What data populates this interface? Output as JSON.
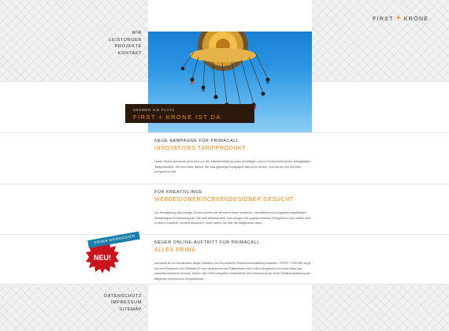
{
  "brand": {
    "logo_left": "FIRST",
    "logo_plus": "+",
    "logo_right": "KRONE"
  },
  "nav": {
    "items": [
      {
        "label": "WIR"
      },
      {
        "label": "LEISTUNGEN"
      },
      {
        "label": "PROJEKTE"
      },
      {
        "label": "KONTAKT"
      }
    ]
  },
  "hero": {
    "banner_subtitle": "NEHMEN SIE PLATZ",
    "banner_title": "FIRST + KRONE IST DA"
  },
  "sections": [
    {
      "kicker": "NEUE KAMPAGNE FÜR PRIMACALL",
      "headline": "INNOVATIVES TARIFPRODUKT",
      "body": "Unser Kunde primacall steht kurz vor der Markteinführung eines neuartigen und in Deutschland bisher einzigartigen Tarifproduktes. Wir sind stolz darauf, die dazugehörige Kampagne fahren zu dürfen, und freuen uns auf eine erregreiche Zeit."
    },
    {
      "kicker": "FÜR KREATIVLINGE",
      "headline": "WEBDESIGNER/SCREENDESIGNER GESUCHT",
      "body": "Zur Verstärkung des Design-Teams suchen wir ab sofort einen kreativen, trendaffinen und begeisterungsfähigen Webdesigner/Screendesigner. Sie sind detailverliebt, überzeugen mit ungewöhnlichen Designideen und wollen sich in einem kreativen Umfeld ausleben? Jetzt haben Sie hier die Möglichkeit dazu."
    },
    {
      "kicker": "NEUER ONLINE-AUFTRITT FÜR PRIMACALL",
      "headline": "ALLES PRIMA",
      "body": "primacall ist ein bundesweit tätiger Anbieter von innovativen Telekommunikationsprodukten. FIRST + KRONE sorgt mit dem Relaunch der Website für eine ansprechende Präsentation des Online-Angebots und setzt dabei auf zukunftsorientierte Technik. Neben der CMS-Integration beinhaltete die Umsetzung auf einer Weiterentwicklung der Magento-Opensource-Shopsoftware."
    }
  ],
  "badge": {
    "ribbon": "PRIMA WEBDESIGN",
    "label": "NEU!"
  },
  "footer": {
    "items": [
      {
        "label": "DATENSCHUTZ"
      },
      {
        "label": "IMPRESSUM"
      },
      {
        "label": "SITEMAP"
      }
    ]
  },
  "colors": {
    "accent": "#f08a1c",
    "banner_bg": "#2b1a0c",
    "badge_red": "#c8141e",
    "ribbon_blue": "#1a7fa8"
  }
}
